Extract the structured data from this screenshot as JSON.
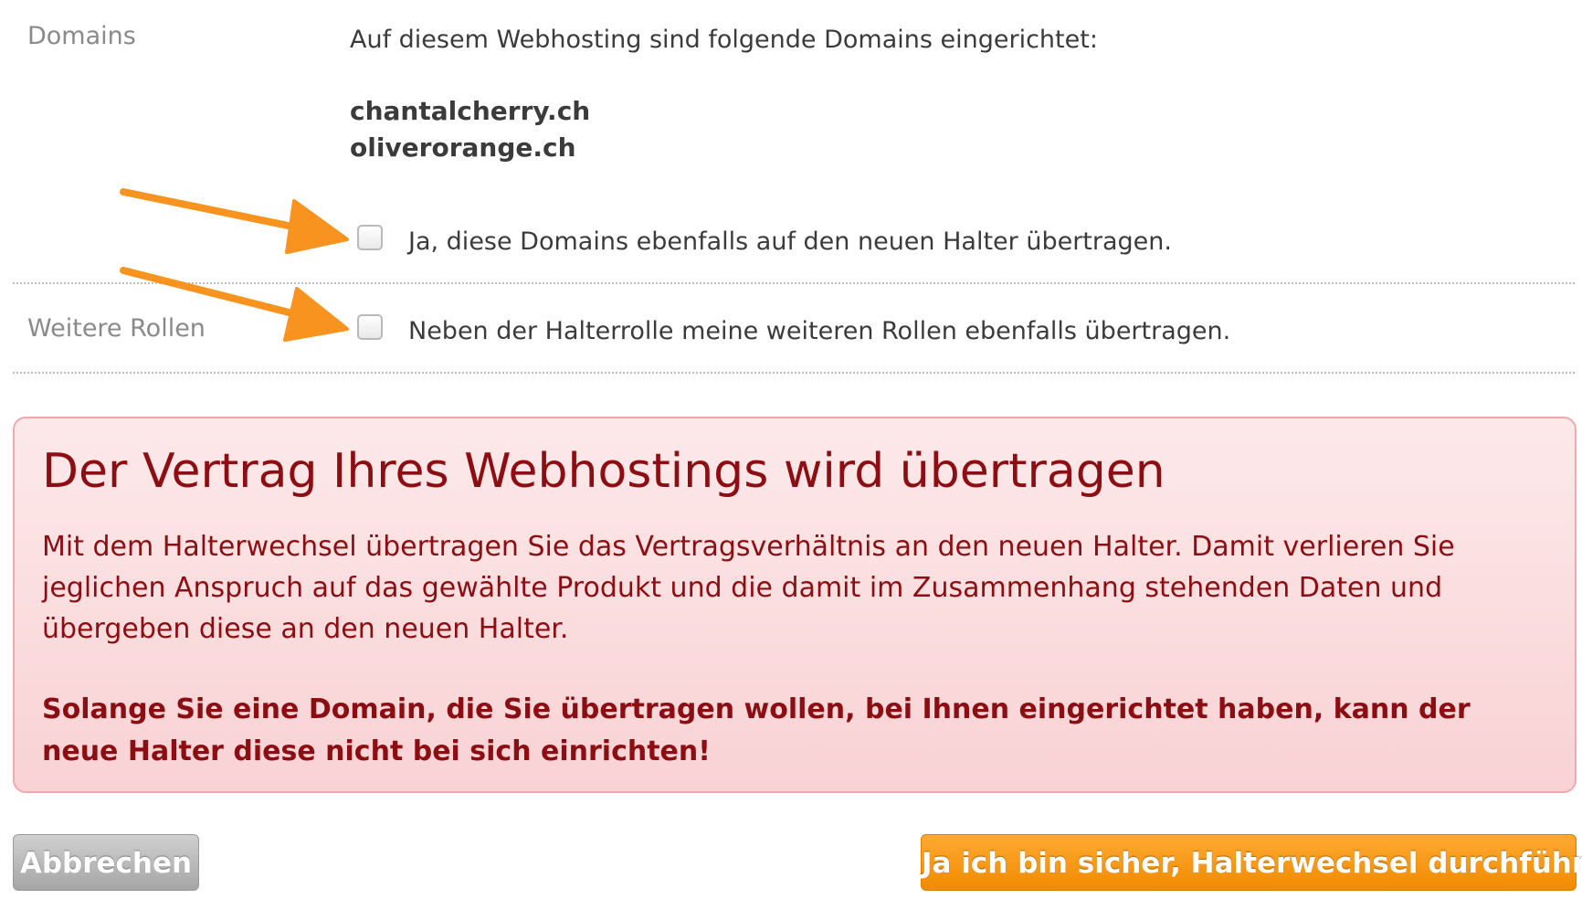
{
  "domains_section": {
    "label": "Domains",
    "intro": "Auf diesem Webhosting sind folgende Domains eingerichtet:",
    "domains": [
      "chantalcherry.ch",
      "oliverorange.ch"
    ],
    "checkbox_label": "Ja, diese Domains ebenfalls auf den neuen Halter übertragen.",
    "checked": false
  },
  "roles_section": {
    "label": "Weitere Rollen",
    "checkbox_label": "Neben der Halterrolle meine weiteren Rollen ebenfalls übertragen.",
    "checked": false
  },
  "warning": {
    "title": "Der Vertrag Ihres Webhostings wird übertragen",
    "text": "Mit dem Halterwechsel übertragen Sie das Vertragsverhältnis an den neuen Halter. Damit verlieren Sie jeglichen Anspruch auf das gewählte Produkt und die damit im Zusammenhang stehenden Daten und übergeben diese an den neuen Halter.",
    "strong": "Solange Sie eine Domain, die Sie übertragen wollen, bei Ihnen eingerichtet haben, kann der neue Halter diese nicht bei sich einrichten!"
  },
  "buttons": {
    "cancel": "Abbrechen",
    "confirm": "Ja ich bin sicher, Halterwechsel durchführen"
  },
  "colors": {
    "arrow": "#f7931e",
    "warning_text": "#8c0e12",
    "confirm_button": "#f7931e"
  }
}
